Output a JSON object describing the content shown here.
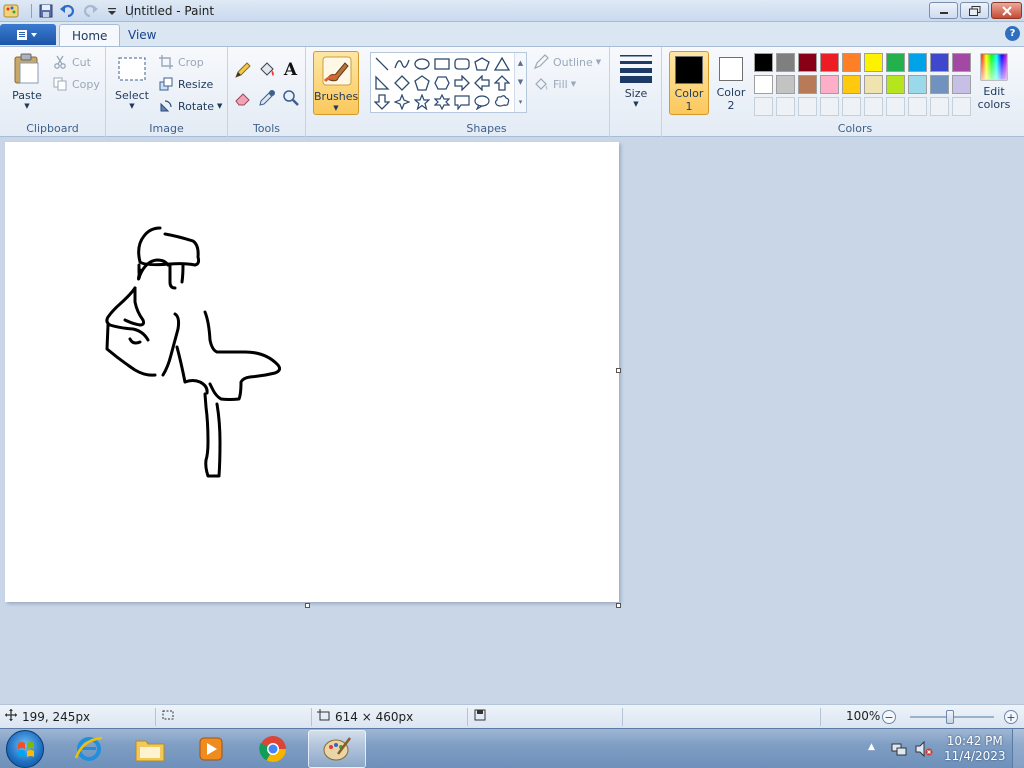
{
  "window": {
    "title": "Untitled - Paint",
    "buttons": [
      "minimize",
      "maximize",
      "close"
    ]
  },
  "tabs": [
    {
      "label": "Home",
      "active": true
    },
    {
      "label": "View",
      "active": false
    }
  ],
  "help_label": "?",
  "clipboard": {
    "group_label": "Clipboard",
    "paste_label": "Paste",
    "cut_label": "Cut",
    "copy_label": "Copy"
  },
  "image": {
    "group_label": "Image",
    "select_label": "Select",
    "crop_label": "Crop",
    "resize_label": "Resize",
    "rotate_label": "Rotate"
  },
  "tools": {
    "group_label": "Tools",
    "text_tool_glyph": "A",
    "items": [
      "pencil-icon",
      "fill-bucket-icon",
      "text-icon",
      "eraser-icon",
      "color-picker-icon",
      "magnifier-icon"
    ]
  },
  "brushes": {
    "label": "Brushes"
  },
  "shapes": {
    "group_label": "Shapes",
    "outline_label": "Outline",
    "fill_label": "Fill"
  },
  "size": {
    "label": "Size"
  },
  "colors": {
    "group_label": "Colors",
    "color1_label": "Color",
    "color1_num": "1",
    "color1_value": "#000000",
    "color2_label": "Color",
    "color2_num": "2",
    "color2_value": "#ffffff",
    "edit_label": "Edit",
    "edit_label2": "colors",
    "palette_row1": [
      "#000000",
      "#7f7f7f",
      "#880015",
      "#ed1c24",
      "#ff7f27",
      "#fff200",
      "#22b14c",
      "#00a2e8",
      "#3f48cc",
      "#a349a4"
    ],
    "palette_row2": [
      "#ffffff",
      "#c3c3c3",
      "#b97a57",
      "#ffaec9",
      "#ffc90e",
      "#efe4b0",
      "#b5e61d",
      "#99d9ea",
      "#7092be",
      "#c8bfe7"
    ]
  },
  "status": {
    "cursor_pos": "199, 245px",
    "canvas_size": "614 × 460px",
    "zoom": "100%",
    "zoom_minus": "−",
    "zoom_plus": "+"
  },
  "taskbar": {
    "apps": [
      "internet-explorer-icon",
      "file-explorer-icon",
      "media-player-icon",
      "chrome-icon",
      "paint-icon"
    ],
    "time": "10:42 PM",
    "date": "11/4/2023"
  }
}
